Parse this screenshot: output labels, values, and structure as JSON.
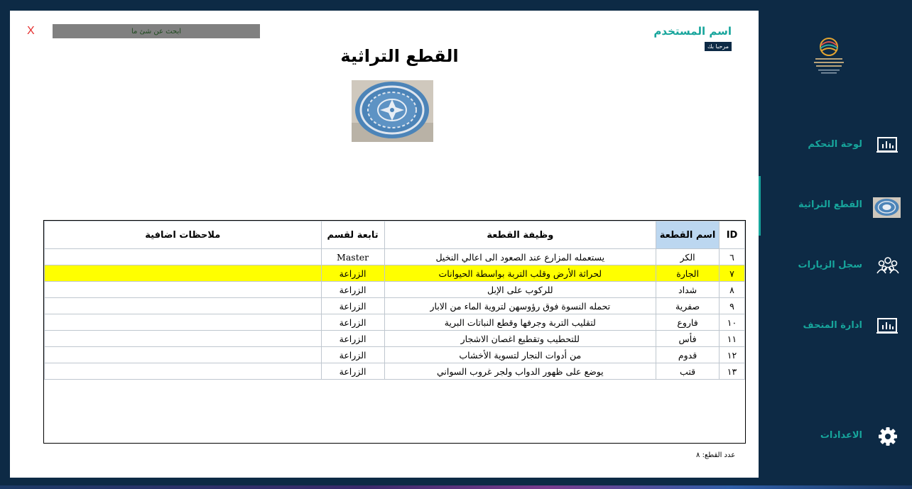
{
  "main": {
    "close_label": "X",
    "search_placeholder": "ابحث عن شئ ما",
    "user_name": "اسم المستخدم",
    "welcome": "مرحبا بك",
    "title": "القطع التراثية"
  },
  "table": {
    "headers": {
      "id": "ID",
      "name": "اسم القطعة",
      "function": "وظيفة القطعة",
      "section": "تابعة لقسم",
      "notes": "ملاحظات اضافية"
    },
    "rows": [
      {
        "id": "٦",
        "name": "الكر",
        "function": "يستعمله المزارع عند الصعود الى اعالي النخيل",
        "section": "Master",
        "notes": ""
      },
      {
        "id": "٧",
        "name": "الجارة",
        "function": "لحراثة الأرض وقلب التربة بواسطة الحيوانات",
        "section": "الزراعة",
        "notes": ""
      },
      {
        "id": "٨",
        "name": "شداد",
        "function": "للركوب على الإبل",
        "section": "الزراعة",
        "notes": ""
      },
      {
        "id": "٩",
        "name": "صفرية",
        "function": "تحمله النسوة فوق رؤوسهن لتروية الماء من الابار",
        "section": "الزراعة",
        "notes": ""
      },
      {
        "id": "١٠",
        "name": "فاروع",
        "function": "لتقليب التربة وجرفها وقطع النباتات البرية",
        "section": "الزراعة",
        "notes": ""
      },
      {
        "id": "١١",
        "name": "فأس",
        "function": "للتحطيب وتقطيع اغصان الاشجار",
        "section": "الزراعة",
        "notes": ""
      },
      {
        "id": "١٢",
        "name": "قدوم",
        "function": "من أدوات النجار لتسوية الأخشاب",
        "section": "الزراعة",
        "notes": ""
      },
      {
        "id": "١٣",
        "name": "قتب",
        "function": "يوضع على ظهور الدواب ولجر غروب السواني",
        "section": "الزراعة",
        "notes": ""
      }
    ],
    "selected_row": 1
  },
  "footer": {
    "count_label": "عدد القطع:",
    "count_value": "٨"
  },
  "sidebar": {
    "items": [
      {
        "label": "لوحة التحكم",
        "icon": "chart-icon"
      },
      {
        "label": "القطع التراثية",
        "icon": "artifact-thumbnail"
      },
      {
        "label": "سجل الزيارات",
        "icon": "visitors-icon"
      },
      {
        "label": "ادارة المتحف",
        "icon": "chart-icon"
      },
      {
        "label": "الاعدادات",
        "icon": "gear-icon"
      }
    ]
  },
  "colors": {
    "accent": "#17a59c",
    "sidebar": "#0d2a45",
    "highlight": "#ffff00",
    "header_active": "#bcd7f0"
  }
}
